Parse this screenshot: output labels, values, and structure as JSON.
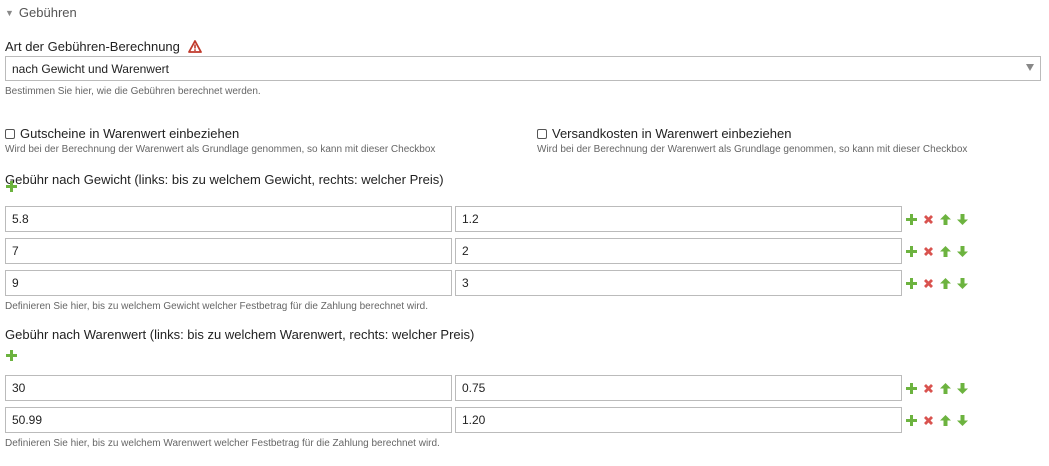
{
  "section": {
    "title": "Gebühren",
    "toggle_icon": "caret-down-icon"
  },
  "fee_type": {
    "label": "Art der Gebühren-Berechnung",
    "warning_icon": "warning-icon",
    "selected": "nach Gewicht und Warenwert",
    "help": "Bestimmen Sie hier, wie die Gebühren berechnet werden."
  },
  "checkboxes": [
    {
      "label": "Gutscheine in Warenwert einbeziehen",
      "checked": false,
      "help": "Wird bei der Berechnung der Warenwert als Grundlage genommen, so kann mit dieser Checkbox"
    },
    {
      "label": "Versandkosten in Warenwert einbeziehen",
      "checked": false,
      "help": "Wird bei der Berechnung der Warenwert als Grundlage genommen, so kann mit dieser Checkbox"
    }
  ],
  "weight_fees": {
    "label": "Gebühr nach Gewicht (links: bis zu welchem Gewicht, rechts: welcher Preis)",
    "rows": [
      {
        "left": "5.8",
        "right": "1.2"
      },
      {
        "left": "7",
        "right": "2"
      },
      {
        "left": "9",
        "right": "3"
      }
    ],
    "help": "Definieren Sie hier, bis zu welchem Gewicht welcher Festbetrag für die Zahlung berechnet wird."
  },
  "value_fees": {
    "label": "Gebühr nach Warenwert (links: bis zu welchem Warenwert, rechts: welcher Preis)",
    "rows": [
      {
        "left": "30",
        "right": "0.75"
      },
      {
        "left": "50.99",
        "right": "1.20"
      }
    ],
    "help": "Definieren Sie hier, bis zu welchem Warenwert welcher Festbetrag für die Zahlung berechnet wird."
  },
  "colors": {
    "add": "#6cb33f",
    "delete": "#d9534f",
    "move": "#6cb33f",
    "warning": "#c0392b"
  }
}
